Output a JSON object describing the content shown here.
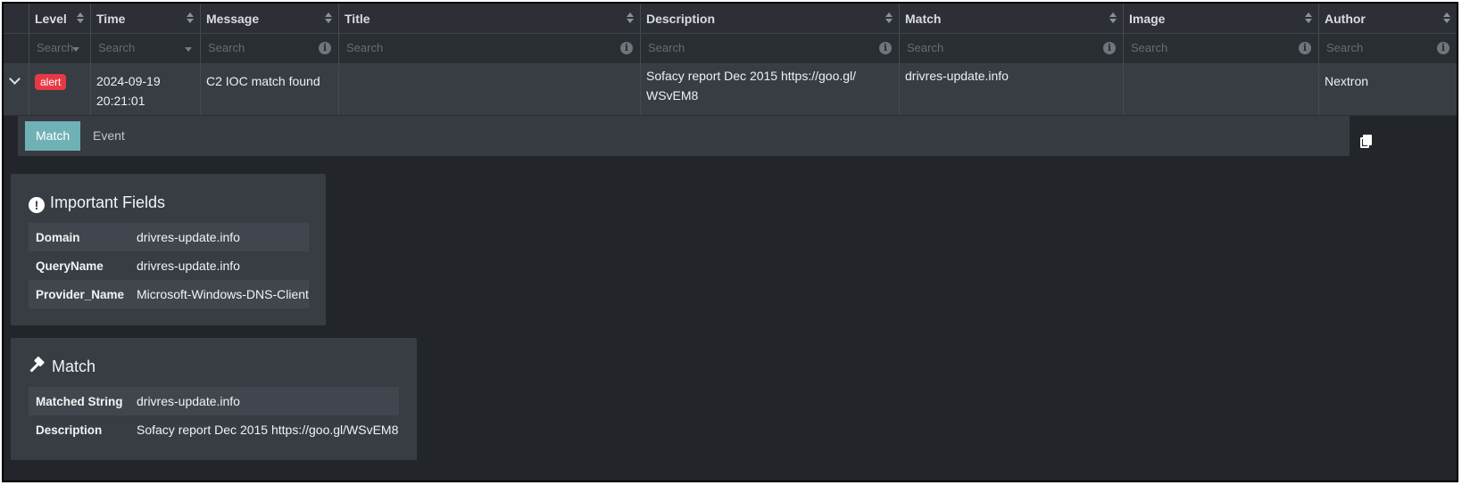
{
  "table": {
    "columns": [
      "Level",
      "Time",
      "Message",
      "Title",
      "Description",
      "Match",
      "Image",
      "Author"
    ],
    "filters": {
      "level_placeholder": "Search",
      "time_placeholder": "Search",
      "message_placeholder": "Search",
      "title_placeholder": "Search",
      "description_placeholder": "Search",
      "match_placeholder": "Search",
      "image_placeholder": "Search",
      "author_placeholder": "Search"
    },
    "row": {
      "level": "alert",
      "time_date": "2024-09-19",
      "time_clock": "20:21:01",
      "message": "C2 IOC match found",
      "title": "",
      "description_line1": "Sofacy report Dec 2015 https://goo.gl/",
      "description_line2": "WSvEM8",
      "match": "drivres-update.info",
      "image": "",
      "author": "Nextron"
    }
  },
  "tabs": {
    "match": "Match",
    "event": "Event"
  },
  "important_fields": {
    "title": "Important Fields",
    "items": [
      {
        "key": "Domain",
        "value": "drivres-update.info"
      },
      {
        "key": "QueryName",
        "value": "drivres-update.info"
      },
      {
        "key": "Provider_Name",
        "value": "Microsoft-Windows-DNS-Client"
      }
    ]
  },
  "match_card": {
    "title": "Match",
    "items": [
      {
        "key": "Matched String",
        "value": "drivres-update.info"
      },
      {
        "key": "Description",
        "value": "Sofacy report Dec 2015 https://goo.gl/WSvEM8"
      }
    ]
  },
  "colors": {
    "alert": "#e63946",
    "tab_active": "#6fb1b4",
    "background": "#22252a"
  }
}
